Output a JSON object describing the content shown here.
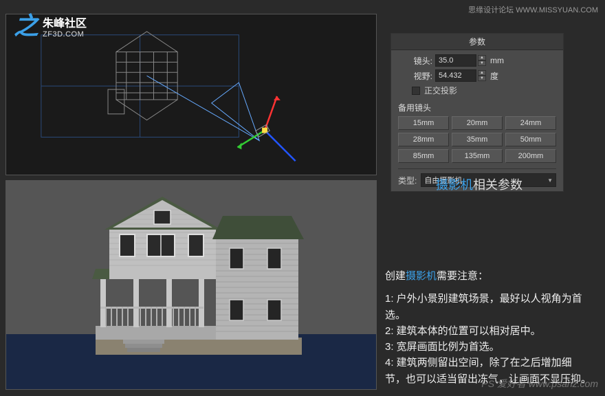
{
  "logo": {
    "glyph": "之",
    "cn": "朱峰社区",
    "url": "ZF3D.COM"
  },
  "top_watermark": "思缘设计论坛  WWW.MISSYUAN.COM",
  "bottom_watermark": "PS 爱好者 www.psahz.com",
  "params": {
    "title": "参数",
    "lens_label": "镜头:",
    "lens_value": "35.0",
    "lens_unit": "mm",
    "fov_label": "视野:",
    "fov_value": "54.432",
    "fov_unit": "度",
    "ortho_label": "正交投影",
    "stock_label": "备用镜头",
    "presets": [
      "15mm",
      "20mm",
      "24mm",
      "28mm",
      "35mm",
      "50mm",
      "85mm",
      "135mm",
      "200mm"
    ],
    "type_label": "类型:",
    "type_value": "自由摄影机"
  },
  "caption_hl": "摄影机",
  "caption_rest": "相关参数",
  "notes": {
    "intro_pre": "创建",
    "intro_hl": "摄影机",
    "intro_post": "需要注意：",
    "lines": [
      "1: 户外小景别建筑场景，最好以人视角为首选。",
      "2: 建筑本体的位置可以相对居中。",
      "3: 宽屏画面比例为首选。",
      "4: 建筑两侧留出空间，除了在之后增加细节，也可以适当留出冻气，让画面不显压抑。"
    ]
  }
}
